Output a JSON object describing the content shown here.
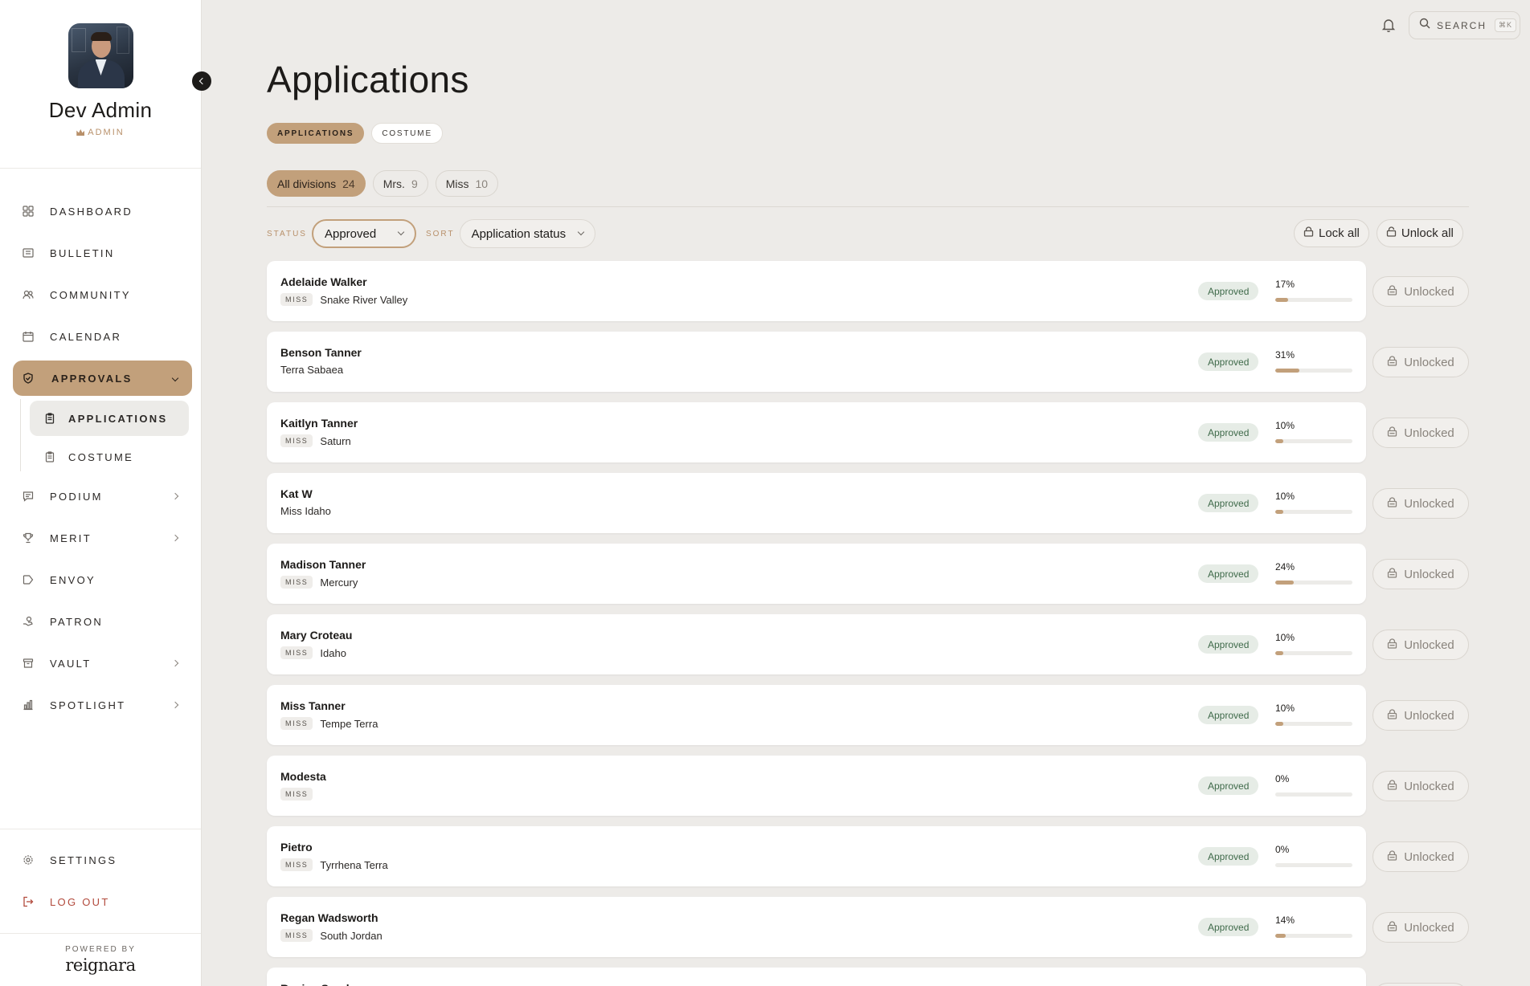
{
  "profile": {
    "name": "Dev Admin",
    "role": "ADMIN"
  },
  "nav": {
    "items": [
      {
        "label": "DASHBOARD",
        "icon": "grid-icon"
      },
      {
        "label": "BULLETIN",
        "icon": "newspaper-icon"
      },
      {
        "label": "COMMUNITY",
        "icon": "users-icon"
      },
      {
        "label": "CALENDAR",
        "icon": "calendar-icon"
      },
      {
        "label": "APPROVALS",
        "icon": "shield-check-icon"
      },
      {
        "label": "PODIUM",
        "icon": "message-icon"
      },
      {
        "label": "MERIT",
        "icon": "trophy-icon"
      },
      {
        "label": "ENVOY",
        "icon": "send-icon"
      },
      {
        "label": "PATRON",
        "icon": "handshake-icon"
      },
      {
        "label": "VAULT",
        "icon": "archive-icon"
      },
      {
        "label": "SPOTLIGHT",
        "icon": "bar-chart-icon"
      }
    ],
    "sub_items": [
      {
        "label": "APPLICATIONS"
      },
      {
        "label": "COSTUME"
      }
    ],
    "settings": "SETTINGS",
    "logout": "LOG OUT"
  },
  "footer": {
    "powered_by": "POWERED BY",
    "brand": "reignara"
  },
  "topbar": {
    "search_label": "SEARCH",
    "shortcut": "⌘K"
  },
  "page": {
    "title": "Applications",
    "tabs": [
      {
        "label": "APPLICATIONS"
      },
      {
        "label": "COSTUME"
      }
    ],
    "divisions": [
      {
        "label": "All divisions",
        "count": "24"
      },
      {
        "label": "Mrs.",
        "count": "9"
      },
      {
        "label": "Miss",
        "count": "10"
      }
    ],
    "filters": {
      "status_label": "STATUS",
      "status_value": "Approved",
      "sort_label": "SORT",
      "sort_value": "Application status"
    },
    "actions": {
      "lock_all": "Lock all",
      "unlock_all": "Unlock all"
    }
  },
  "applications": [
    {
      "name": "Adelaide Walker",
      "division": "MISS",
      "title": "Snake River Valley",
      "status": "Approved",
      "progress": "17%",
      "progress_value": 17,
      "lock": "Unlocked"
    },
    {
      "name": "Benson Tanner",
      "division": "",
      "title": "Terra Sabaea",
      "status": "Approved",
      "progress": "31%",
      "progress_value": 31,
      "lock": "Unlocked"
    },
    {
      "name": "Kaitlyn Tanner",
      "division": "MISS",
      "title": "Saturn",
      "status": "Approved",
      "progress": "10%",
      "progress_value": 10,
      "lock": "Unlocked"
    },
    {
      "name": "Kat W",
      "division": "",
      "title": "Miss Idaho",
      "status": "Approved",
      "progress": "10%",
      "progress_value": 10,
      "lock": "Unlocked"
    },
    {
      "name": "Madison Tanner",
      "division": "MISS",
      "title": "Mercury",
      "status": "Approved",
      "progress": "24%",
      "progress_value": 24,
      "lock": "Unlocked"
    },
    {
      "name": "Mary Croteau",
      "division": "MISS",
      "title": "Idaho",
      "status": "Approved",
      "progress": "10%",
      "progress_value": 10,
      "lock": "Unlocked"
    },
    {
      "name": "Miss Tanner",
      "division": "MISS",
      "title": "Tempe Terra",
      "status": "Approved",
      "progress": "10%",
      "progress_value": 10,
      "lock": "Unlocked"
    },
    {
      "name": "Modesta",
      "division": "MISS",
      "title": "",
      "status": "Approved",
      "progress": "0%",
      "progress_value": 0,
      "lock": "Unlocked"
    },
    {
      "name": "Pietro",
      "division": "MISS",
      "title": "Tyrrhena Terra",
      "status": "Approved",
      "progress": "0%",
      "progress_value": 0,
      "lock": "Unlocked"
    },
    {
      "name": "Regan Wadsworth",
      "division": "MISS",
      "title": "South Jordan",
      "status": "Approved",
      "progress": "14%",
      "progress_value": 14,
      "lock": "Unlocked"
    },
    {
      "name": "Regina Sparks",
      "division": "",
      "title": "",
      "status": "",
      "progress": "",
      "progress_value": 0,
      "lock": ""
    }
  ],
  "colors": {
    "accent": "#c2a07b",
    "approved_bg": "#e6ece6",
    "approved_text": "#3f6a4a",
    "logout": "#b24a3c"
  }
}
